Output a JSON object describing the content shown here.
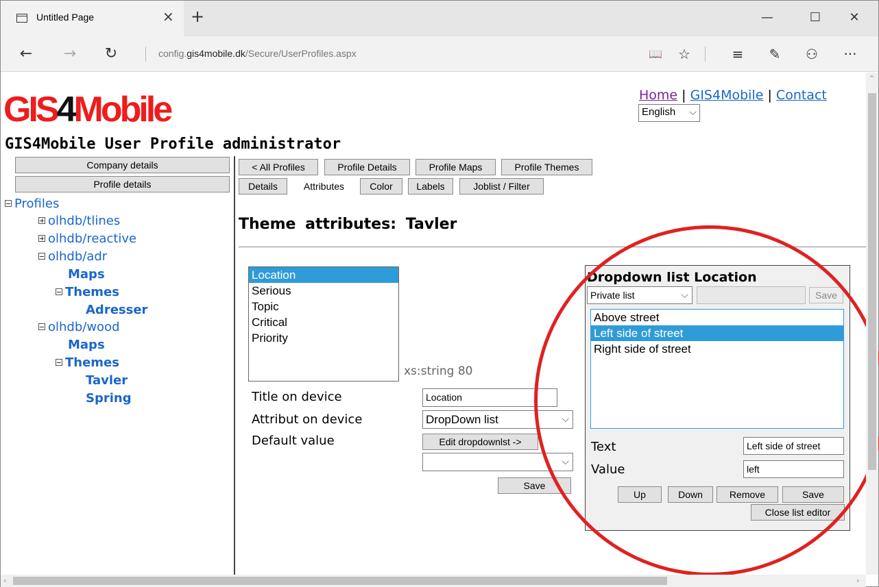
{
  "browser": {
    "tab_title": "Untitled Page",
    "tab_close": "×",
    "new_tab": "+",
    "minimize": "—",
    "maximize": "☐",
    "close": "✕",
    "back": "←",
    "forward": "→",
    "refresh": "↻",
    "address_prefix": "config.",
    "address_domain": "gis4mobile.dk",
    "address_path": "/Secure/UserProfiles.aspx",
    "reading_view": "📖",
    "favorite": "☆",
    "hub": "≡",
    "web_note": "✎",
    "share": "⚇",
    "more": "···"
  },
  "header": {
    "logo_red_1": "GIS",
    "logo_black": "4",
    "logo_red_2": "Mobile",
    "page_title": "GIS4Mobile User Profile administrator",
    "links": [
      "Home",
      "GIS4Mobile",
      "Contact"
    ],
    "link_separator": "|",
    "language": "English"
  },
  "sidebar": {
    "buttons": [
      "Company details",
      "Profile details"
    ],
    "tree": {
      "root": "Profiles",
      "nodes": [
        "olhdb/tlines",
        "olhdb/reactive",
        "olhdb/adr",
        "Maps",
        "Themes",
        "Adresser",
        "olhdb/wood",
        "Maps",
        "Themes",
        "Tavler",
        "Spring"
      ]
    }
  },
  "tabs_row1": [
    "< All Profiles",
    "Profile Details",
    "Profile Maps",
    "Profile Themes"
  ],
  "tabs_row2": [
    "Details",
    "Attributes",
    "Color",
    "Labels",
    "Joblist / Filter"
  ],
  "theme": {
    "heading_label": "Theme attributes:",
    "heading_name": "Tavler",
    "attributes": [
      "Location",
      "Serious",
      "Topic",
      "Critical",
      "Priority"
    ],
    "selected_attribute": "Location",
    "type_note": "xs:string 80",
    "form": {
      "title_label": "Title on device",
      "title_value": "Location",
      "attribut_label": "Attribut on device",
      "attribut_value": "DropDown list",
      "default_label": "Default value",
      "edit_button": "Edit dropdownlst ->",
      "default_value": "",
      "save_button": "Save"
    }
  },
  "dropdown_editor": {
    "title": "Dropdown list Location",
    "list_type": "Private list",
    "save_disabled": "Save",
    "items": [
      "Above street",
      "Left side of street",
      "Right side of street"
    ],
    "selected_item": "Left side of street",
    "text_label": "Text",
    "text_value": "Left side of street",
    "value_label": "Value",
    "value_value": "left",
    "buttons": [
      "Up",
      "Down",
      "Remove",
      "Save"
    ],
    "close_button": "Close list editor"
  },
  "colors": {
    "selection": "#2f9bd9",
    "link": "#1a66cc",
    "visited_link": "#7b1fa2",
    "logo_red": "#ee1c1c",
    "annotation": "#e02121"
  }
}
